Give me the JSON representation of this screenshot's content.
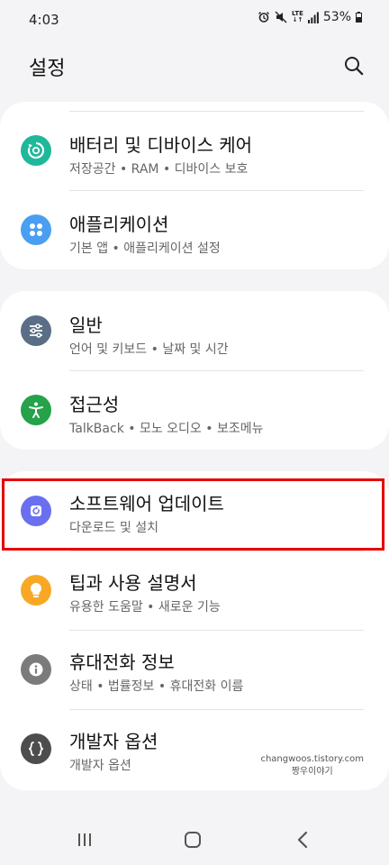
{
  "status_bar": {
    "time": "4:03",
    "battery": "53%",
    "network": "LTE"
  },
  "header": {
    "title": "설정"
  },
  "groups": [
    {
      "items": [
        {
          "title": "배터리 및 디바이스 케어",
          "subtitle": "저장공간  •  RAM  •  디바이스 보호",
          "icon": "device-care-icon",
          "color": "#1fb89a"
        },
        {
          "title": "애플리케이션",
          "subtitle": "기본 앱  •  애플리케이션 설정",
          "icon": "apps-icon",
          "color": "#4a9ff0"
        }
      ]
    },
    {
      "items": [
        {
          "title": "일반",
          "subtitle": "언어 및 키보드  •  날짜 및 시간",
          "icon": "sliders-icon",
          "color": "#5a6e86"
        },
        {
          "title": "접근성",
          "subtitle": "TalkBack  •  모노 오디오  •  보조메뉴",
          "icon": "accessibility-icon",
          "color": "#25a24a"
        }
      ]
    },
    {
      "items": [
        {
          "title": "소프트웨어 업데이트",
          "subtitle": "다운로드 및 설치",
          "icon": "software-update-icon",
          "color": "#6a6ff0"
        },
        {
          "title": "팁과 사용 설명서",
          "subtitle": "유용한 도움말  •  새로운 기능",
          "icon": "lightbulb-icon",
          "color": "#f9a825"
        },
        {
          "title": "휴대전화 정보",
          "subtitle": "상태  •  법률정보  •  휴대전화 이름",
          "icon": "info-icon",
          "color": "#7b7b7b"
        },
        {
          "title": "개발자 옵션",
          "subtitle": "개발자 옵션",
          "icon": "developer-options-icon",
          "color": "#4d4d4d"
        }
      ]
    }
  ],
  "highlight_color": "#e60000",
  "watermark": {
    "line1": "changwoos.tistory.com",
    "line2": "짱우이야기"
  }
}
